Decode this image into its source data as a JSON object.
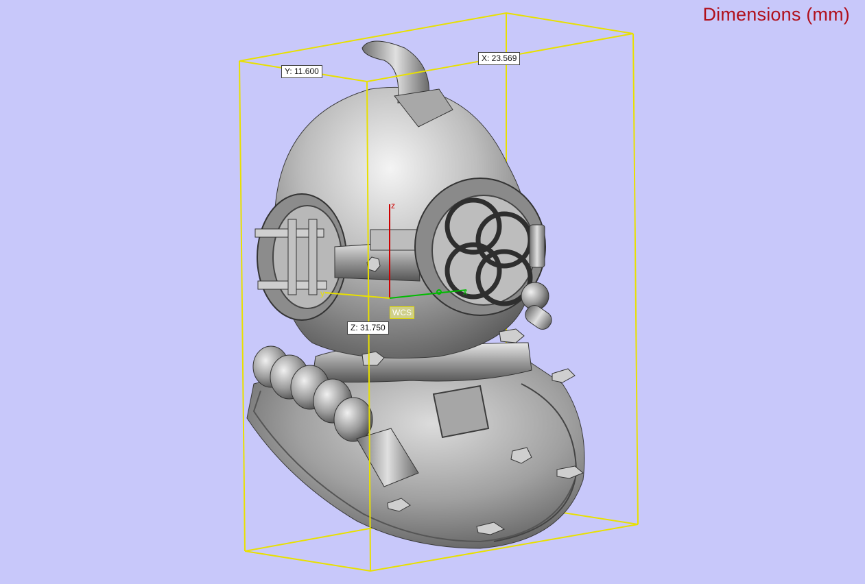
{
  "viewport": {
    "title": "Dimensions (mm)",
    "background_color": "#c8c8fa",
    "title_color": "#b0101c",
    "bbox_color": "#e8e000"
  },
  "dimensions": {
    "x_label": "X: 23.569",
    "y_label": "Y: 11.600",
    "z_label": "Z: 31.750"
  },
  "axes": {
    "wcs_label": "WCS",
    "z_axis": "z",
    "y_axis": "y",
    "x_axis": "x",
    "z_color": "#cc0000",
    "x_color": "#00bb00"
  },
  "model": {
    "name_icon": "diving-helmet-model",
    "shade_color": "#a8a8a8"
  }
}
